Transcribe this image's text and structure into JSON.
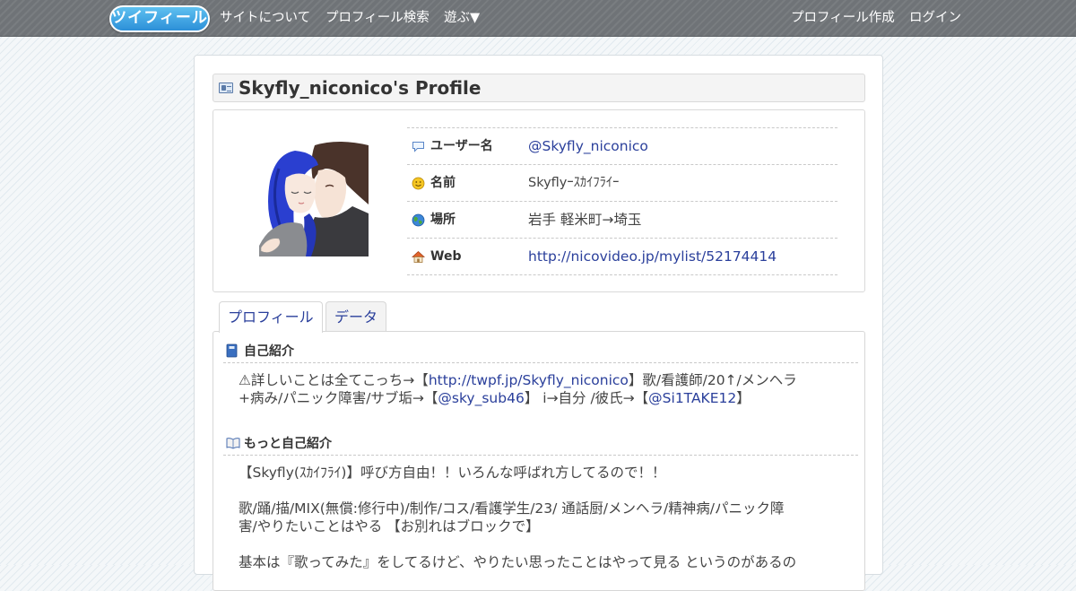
{
  "nav": {
    "logo": "ツイフィール",
    "about": "サイトについて",
    "search": "プロフィール検索",
    "play": "遊ぶ▼",
    "create": "プロフィール作成",
    "login": "ログイン"
  },
  "profile": {
    "title": "Skyfly_niconico's Profile",
    "rows": [
      {
        "label": "ユーザー名",
        "value": "@Skyfly_niconico",
        "icon": "speech-bubble-icon"
      },
      {
        "label": "名前",
        "value": "Skyflyｰｽｶｲﾌﾗｲｰ",
        "icon": "smiley-icon"
      },
      {
        "label": "場所",
        "value": "岩手 軽米町→埼玉",
        "icon": "globe-icon"
      },
      {
        "label": "Web",
        "value": "http://nicovideo.jp/mylist/52174414",
        "icon": "house-icon"
      }
    ]
  },
  "tabs": [
    "プロフィール",
    "データ"
  ],
  "sections": {
    "intro_title": "自己紹介",
    "intro_1": "⚠詳しいことは全てこっち→【",
    "intro_link1": "http://twpf.jp/Skyfly_niconico",
    "intro_2": "】歌/看護師/20↑/メンヘラ",
    "intro_3": "+病み/パニック障害/サブ垢→【",
    "intro_link2": "@sky_sub46",
    "intro_4": "】 i→自分 /彼氏→【",
    "intro_link3": "@Si1TAKE12",
    "intro_5": "】",
    "more_title": "もっと自己紹介",
    "more_p1": "【Skyfly(ｽｶｲﾌﾗｲ)】呼び方自由！！いろんな呼ばれ方してるので！！",
    "more_p2_l1": "歌/踊/描/MIX(無償:修行中)/制作/コス/看護学生/23/ 通話厨/メンヘラ/精神病/パニック障",
    "more_p2_l2": "害/やりたいことはやる 【お別れはブロックで】",
    "more_p3": "基本は『歌ってみた』をしてるけど、やりたい思ったことはやって見る というのがあるの"
  },
  "colors": {
    "link": "#2a3f9b",
    "navbar": "#6f7377",
    "logo": "#2c8fd8"
  }
}
